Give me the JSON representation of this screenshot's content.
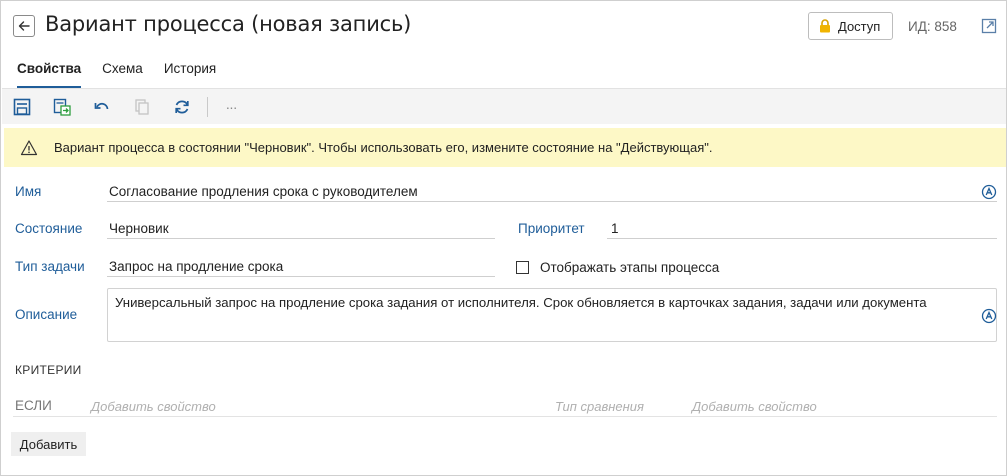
{
  "header": {
    "title": "Вариант процесса (новая запись)",
    "access_label": "Доступ",
    "id_label": "ИД: 858"
  },
  "tabs": [
    {
      "label": "Свойства",
      "active": true
    },
    {
      "label": "Схема",
      "active": false
    },
    {
      "label": "История",
      "active": false
    }
  ],
  "toolbar": {
    "icons": [
      "save-icon",
      "save-and-close-icon",
      "undo-icon",
      "copy-icon",
      "refresh-icon",
      "more-icon"
    ],
    "more_label": "···"
  },
  "warning": {
    "text": "Вариант процесса в состоянии \"Черновик\". Чтобы использовать его, измените состояние на \"Действующая\"."
  },
  "form": {
    "name_label": "Имя",
    "name_value": "Согласование продления срока с руководителем",
    "state_label": "Состояние",
    "state_value": "Черновик",
    "priority_label": "Приоритет",
    "priority_value": "1",
    "task_type_label": "Тип задачи",
    "task_type_value": "Запрос на продление срока",
    "show_stages_label": "Отображать этапы процесса",
    "show_stages_checked": false,
    "description_label": "Описание",
    "description_value": "Универсальный запрос на продление срока задания от исполнителя. Срок обновляется в карточках задания, задачи или документа"
  },
  "criteria": {
    "section_title": "КРИТЕРИИ",
    "if_label": "ЕСЛИ",
    "add_property_placeholder_1": "Добавить свойство",
    "comparison_type_placeholder": "Тип сравнения",
    "add_property_placeholder_2": "Добавить свойство",
    "add_button": "Добавить"
  },
  "colors": {
    "accent": "#1f5d99",
    "warning_bg": "#fdf8c6",
    "toolbar_bg": "#f4f4f4"
  }
}
